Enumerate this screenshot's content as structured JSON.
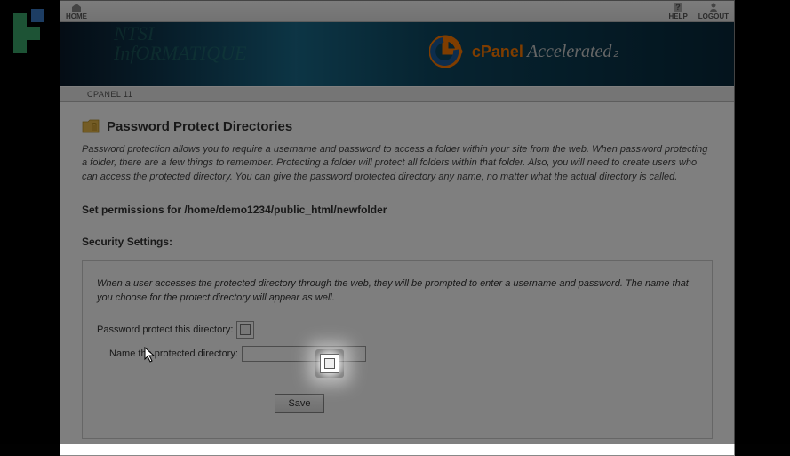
{
  "topbar": {
    "home": "HOME",
    "help": "HELP",
    "logout": "LOGOUT"
  },
  "banner": {
    "watermark_line1": "NTSI",
    "watermark_line2": "InfORMATIQUE",
    "brand": "cPanel",
    "suffix": "Accelerated",
    "sub": "2"
  },
  "breadcrumb": "CPANEL 11",
  "page": {
    "title": "Password Protect Directories",
    "description": "Password protection allows you to require a username and password to access a folder within your site from the web. When password protecting a folder, there are a few things to remember. Protecting a folder will protect all folders within that folder. Also, you will need to create users who can access the protected directory. You can give the password protected directory any name, no matter what the actual directory is called.",
    "permissions_prefix": "Set permissions for ",
    "permissions_path": "/home/demo1234/public_html/newfolder"
  },
  "settings": {
    "heading": "Security Settings:",
    "hint": "When a user accesses the protected directory through the web, they will be prompted to enter a username and password. The name that you choose for the protect directory will appear as well.",
    "checkbox_label": "Password protect this directory:",
    "name_label": "Name the protected directory:",
    "name_value": "",
    "save": "Save"
  }
}
